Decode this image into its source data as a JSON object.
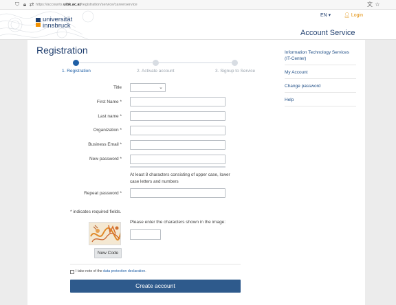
{
  "browser": {
    "url_prefix": "https://accounts.",
    "url_domain": "uibk.ac.at",
    "url_path": "/registration/service/careerservice"
  },
  "header": {
    "logo_line1": "universität",
    "logo_line2": "innsbruck",
    "lang": "EN ▾",
    "login": "Login",
    "service_title": "Account Service"
  },
  "page": {
    "title": "Registration"
  },
  "steps": [
    {
      "label": "1. Registration"
    },
    {
      "label": "2. Activate account"
    },
    {
      "label": "3. Signup to Service"
    }
  ],
  "form": {
    "title_label": "Title",
    "first_name_label": "First Name *",
    "last_name_label": "Last name *",
    "organization_label": "Organization *",
    "email_label": "Business Email *",
    "password_label": "New password *",
    "password_hint": "At least 8 characters consisting of upper case, lower case letters and numbers",
    "repeat_password_label": "Repeat password *",
    "required_note": "* indicates required fields.",
    "captcha_prompt": "Please enter the characters shown in the image:",
    "new_code_label": "New Code",
    "declaration_prefix": "I take note of the ",
    "declaration_link": "data protection declaration",
    "declaration_suffix": ".",
    "submit_label": "Create account"
  },
  "sidebar": {
    "items": [
      {
        "label": "Information Technology Services (IT-Center)"
      },
      {
        "label": "My Account"
      },
      {
        "label": "Change password"
      },
      {
        "label": "Help"
      }
    ]
  },
  "colors": {
    "brand_blue": "#1f3e6e",
    "accent_orange": "#f39200",
    "button_blue": "#2e5a8c"
  }
}
